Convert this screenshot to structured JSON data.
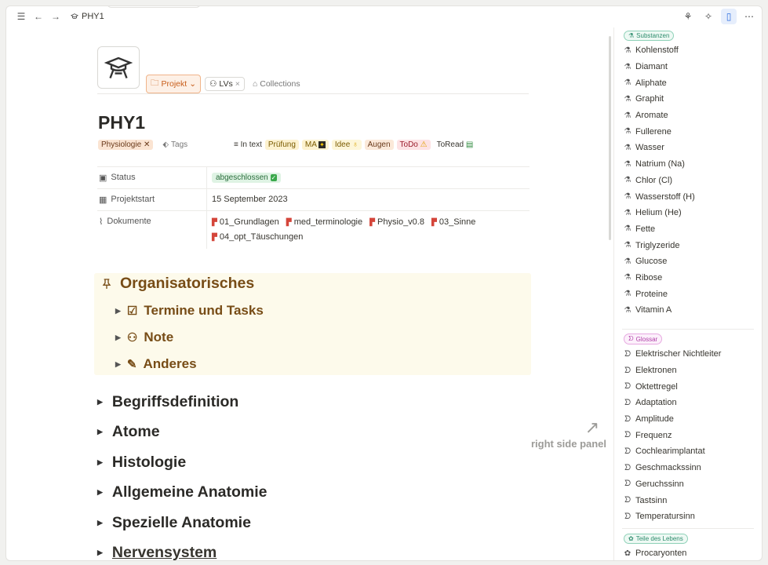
{
  "topbar": {
    "breadcrumb": "PHY1"
  },
  "page": {
    "title": "PHY1",
    "meta": {
      "project": "Projekt",
      "lvs": "LVs",
      "collections": "Collections"
    },
    "tags_inline": {
      "physiologie": "Physiologie",
      "tags_label": "Tags"
    },
    "tags_right": {
      "in_text": "In text",
      "pruefung": "Prüfung",
      "ma": "MA",
      "idee": "Idee",
      "augen": "Augen",
      "todo": "ToDo",
      "toread": "ToRead"
    },
    "properties": {
      "status_label": "Status",
      "status_value": "abgeschlossen",
      "start_label": "Projektstart",
      "start_value": "15 September 2023",
      "docs_label": "Dokumente",
      "docs": [
        "01_Grundlagen",
        "med_terminologie",
        "Physio_v0.8",
        "03_Sinne",
        "04_opt_Täuschungen"
      ]
    },
    "callout": {
      "heading": "Organisatorisches",
      "items": [
        "Termine und Tasks",
        "Note",
        "Anderes"
      ]
    },
    "toggles": [
      "Begriffsdefinition",
      "Atome",
      "Histologie",
      "Allgemeine Anatomie",
      "Spezielle Anatomie",
      "Nervensystem"
    ],
    "annotation": "right side panel"
  },
  "right_panel": {
    "substanzen": {
      "tag": "Substanzen",
      "items": [
        "Kohlenstoff",
        "Diamant",
        "Aliphate",
        "Graphit",
        "Aromate",
        "Fullerene",
        "Wasser",
        "Natrium (Na)",
        "Chlor (Cl)",
        "Wasserstoff (H)",
        "Helium (He)",
        "Fette",
        "Triglyzeride",
        "Glucose",
        "Ribose",
        "Proteine",
        "Vitamin A"
      ]
    },
    "glossar": {
      "tag": "Glossar",
      "items": [
        "Elektrischer Nichtleiter",
        "Elektronen",
        "Oktettregel",
        "Adaptation",
        "Amplitude",
        "Frequenz",
        "Cochlearimplantat",
        "Geschmackssinn",
        "Geruchssinn",
        "Tastsinn",
        "Temperatursinn"
      ]
    },
    "leben": {
      "tag": "Teile des Lebens",
      "items": [
        "Procaryonten"
      ]
    }
  }
}
